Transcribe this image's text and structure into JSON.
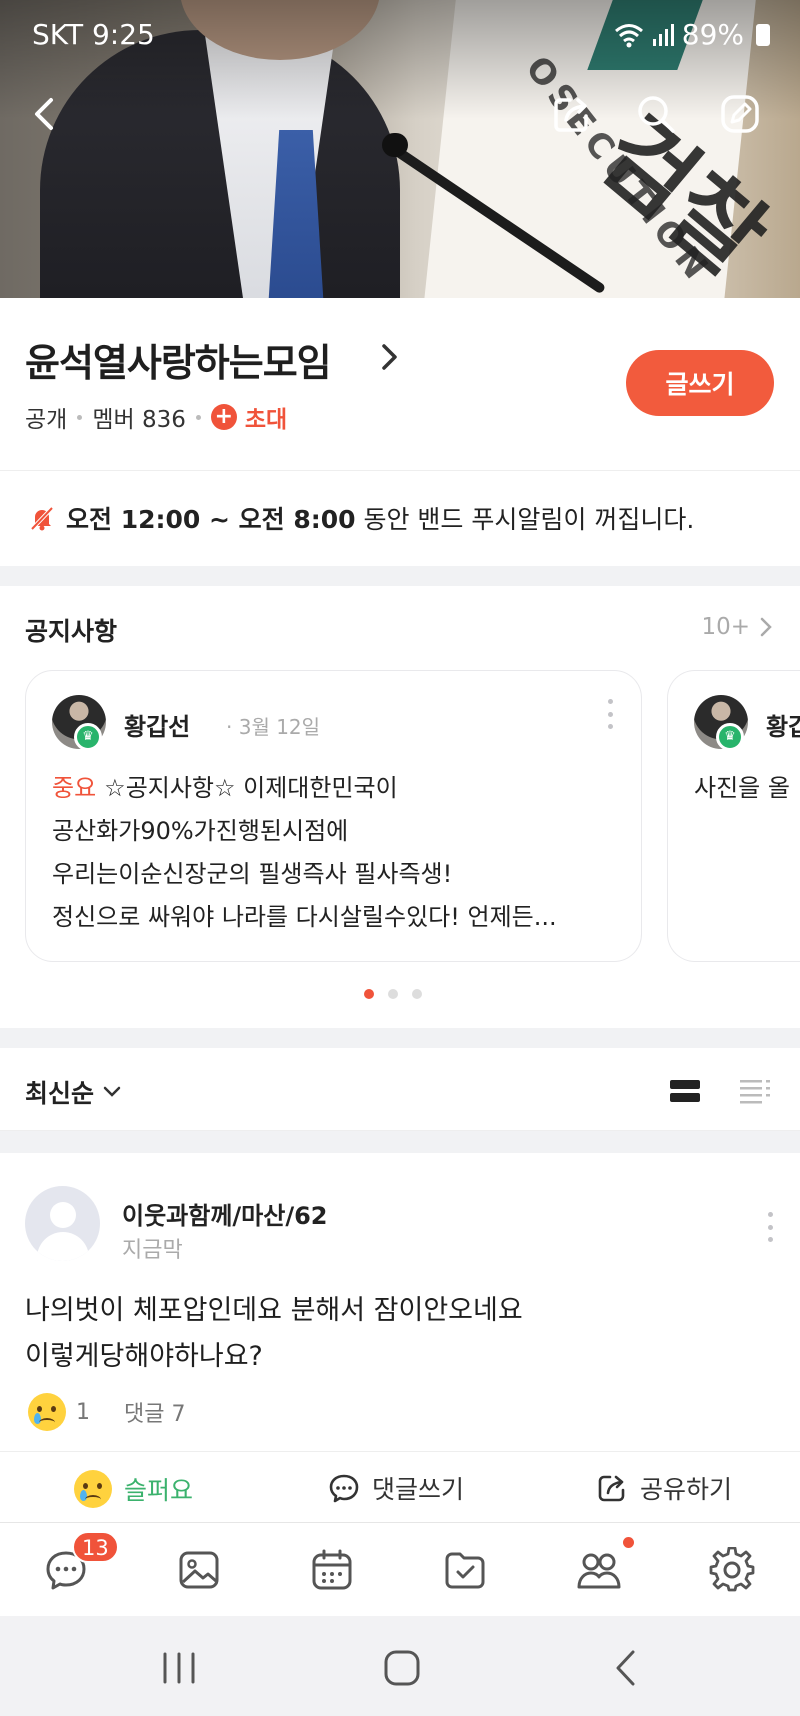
{
  "status_bar": {
    "carrier_time": "SKT 9:25",
    "battery": "89%"
  },
  "band": {
    "name": "윤석열사랑하는모임",
    "visibility": "공개",
    "member_count": "멤버 836",
    "invite_label": "초대",
    "write_button": "글쓰기"
  },
  "mute_notice": {
    "time_range": "오전 12:00 ~ 오전 8:00",
    "text": " 동안 밴드 푸시알림이 꺼집니다."
  },
  "notices": {
    "title": "공지사항",
    "more": "10+",
    "cards": [
      {
        "author": "황갑선",
        "date": "· 3월 12일",
        "tag": "중요",
        "lines": [
          "☆공지사항☆ 이제대한민국이",
          "공산화가90%가진행된시점에",
          "우리는이순신장군의 필생즉사 필사즉생!",
          "정신으로 싸워야 나라를 다시살릴수있다! 언제든..."
        ]
      },
      {
        "author": "황갑",
        "line": "사진을 올"
      }
    ]
  },
  "sort": {
    "label": "최신순"
  },
  "post": {
    "author": "이웃과함께/마산/62",
    "time": "지금막",
    "lines": [
      "나의벗이 체포압인데요 분해서 잠이안오네요",
      "이렇게당해야하나요?"
    ],
    "reaction_count": "1",
    "comments": "댓글 7",
    "actions": {
      "sad": "슬퍼요",
      "comment": "댓글쓰기",
      "share": "공유하기"
    }
  },
  "bottom_nav": {
    "chat_badge": "13"
  },
  "colors": {
    "accent": "#f25b3d",
    "green": "#3bb26d"
  }
}
